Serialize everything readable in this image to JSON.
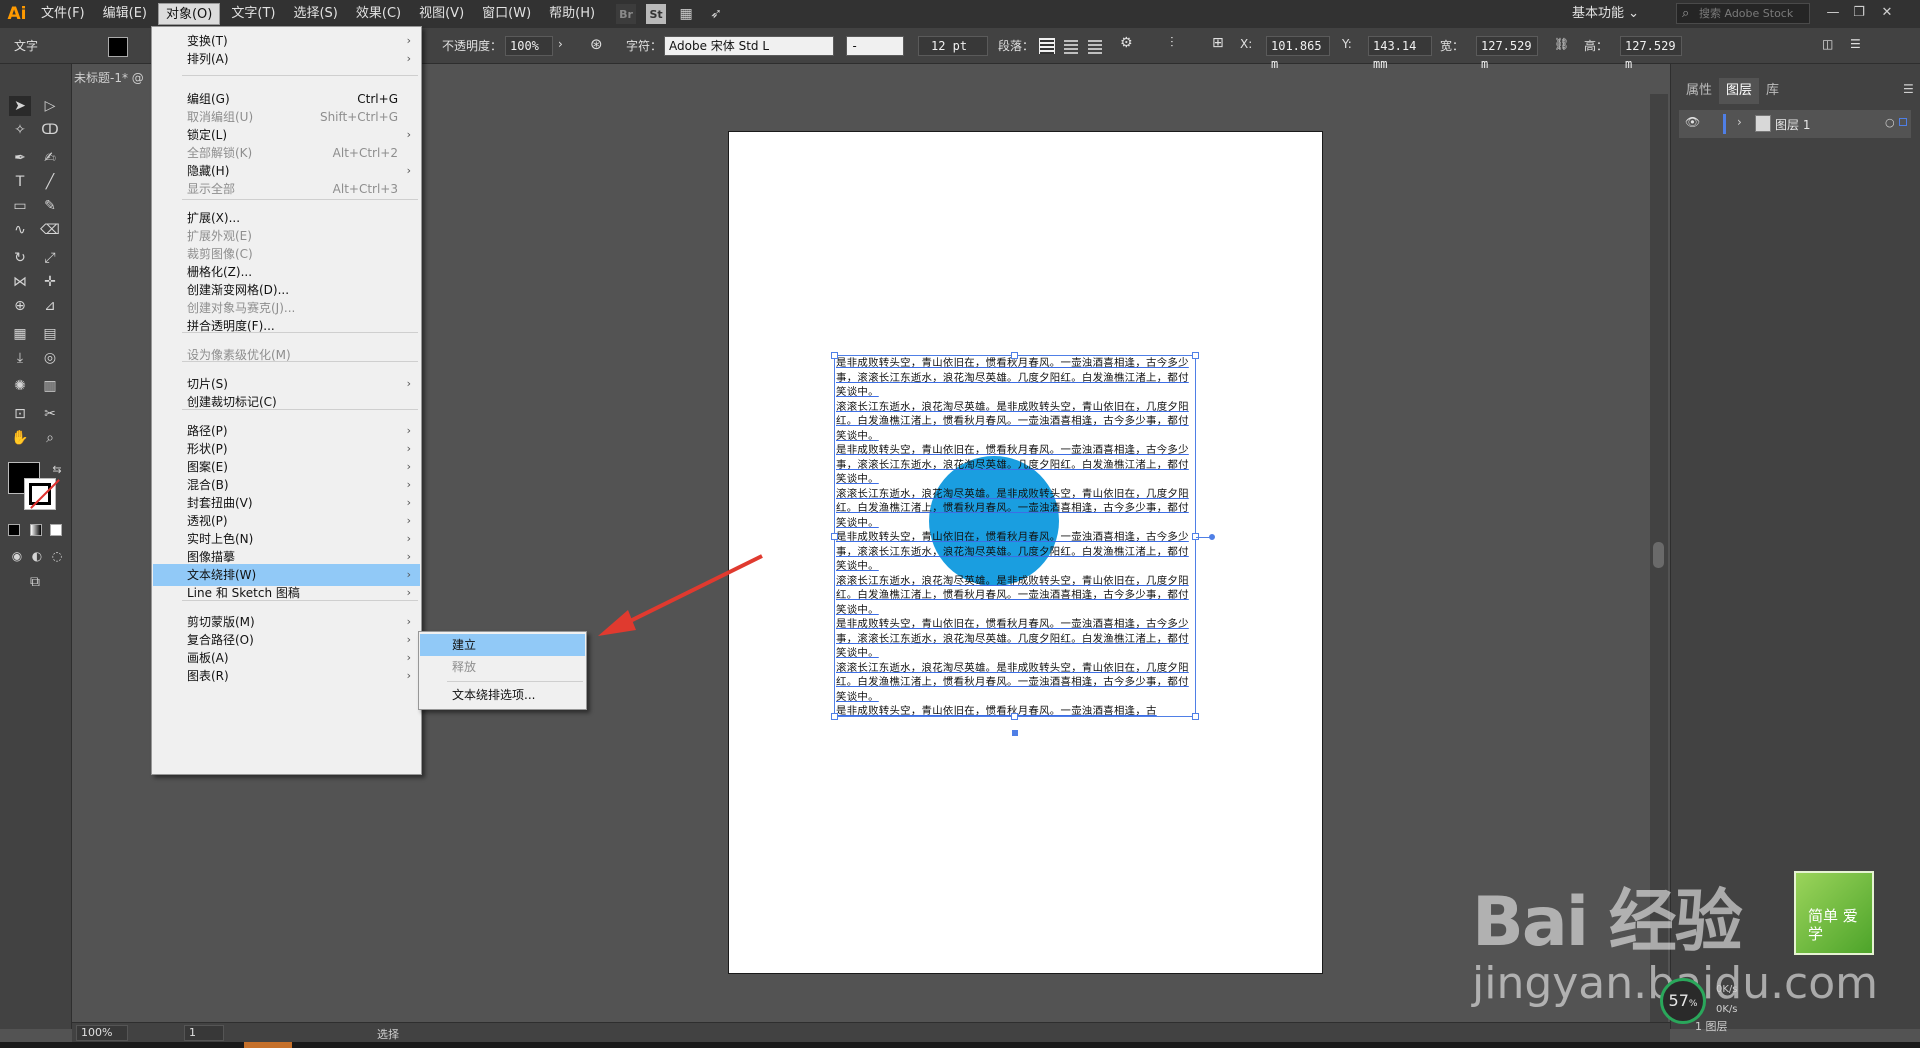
{
  "app": {
    "logo": "Ai"
  },
  "menubar": {
    "items": [
      "文件(F)",
      "编辑(E)",
      "对象(O)",
      "文字(T)",
      "选择(S)",
      "效果(C)",
      "视图(V)",
      "窗口(W)",
      "帮助(H)"
    ],
    "icons": [
      "Br",
      "St"
    ],
    "workspace": "基本功能",
    "search_placeholder": "搜索 Adobe Stock"
  },
  "controlbar": {
    "tool_label": "文字",
    "opacity_label": "不透明度：",
    "opacity_value": "100%",
    "char_label": "字符：",
    "font_name": "Adobe 宋体 Std L",
    "font_style": "-",
    "font_size": "12 pt",
    "para_label": "段落：",
    "x_label": "X:",
    "x_value": "101.865 m",
    "y_label": "Y:",
    "y_value": "143.14 mm",
    "w_label": "宽：",
    "w_value": "127.529 m",
    "h_label": "高：",
    "h_value": "127.529 m"
  },
  "document": {
    "tab_title": "未标题-1* @"
  },
  "object_menu": {
    "items": [
      {
        "label": "变换(T)",
        "shortcut": "",
        "submenu": true,
        "disabled": false
      },
      {
        "label": "排列(A)",
        "shortcut": "",
        "submenu": true,
        "disabled": false
      },
      {
        "label": "编组(G)",
        "shortcut": "Ctrl+G",
        "submenu": false,
        "disabled": false
      },
      {
        "label": "取消编组(U)",
        "shortcut": "Shift+Ctrl+G",
        "submenu": false,
        "disabled": true
      },
      {
        "label": "锁定(L)",
        "shortcut": "",
        "submenu": true,
        "disabled": false
      },
      {
        "label": "全部解锁(K)",
        "shortcut": "Alt+Ctrl+2",
        "submenu": false,
        "disabled": true
      },
      {
        "label": "隐藏(H)",
        "shortcut": "",
        "submenu": true,
        "disabled": false
      },
      {
        "label": "显示全部",
        "shortcut": "Alt+Ctrl+3",
        "submenu": false,
        "disabled": true
      },
      {
        "label": "扩展(X)...",
        "shortcut": "",
        "submenu": false,
        "disabled": false
      },
      {
        "label": "扩展外观(E)",
        "shortcut": "",
        "submenu": false,
        "disabled": true
      },
      {
        "label": "裁剪图像(C)",
        "shortcut": "",
        "submenu": false,
        "disabled": true
      },
      {
        "label": "栅格化(Z)...",
        "shortcut": "",
        "submenu": false,
        "disabled": false
      },
      {
        "label": "创建渐变网格(D)...",
        "shortcut": "",
        "submenu": false,
        "disabled": false
      },
      {
        "label": "创建对象马赛克(J)...",
        "shortcut": "",
        "submenu": false,
        "disabled": true
      },
      {
        "label": "拼合透明度(F)...",
        "shortcut": "",
        "submenu": false,
        "disabled": false
      },
      {
        "label": "设为像素级优化(M)",
        "shortcut": "",
        "submenu": false,
        "disabled": true
      },
      {
        "label": "切片(S)",
        "shortcut": "",
        "submenu": true,
        "disabled": false
      },
      {
        "label": "创建裁切标记(C)",
        "shortcut": "",
        "submenu": false,
        "disabled": false
      },
      {
        "label": "路径(P)",
        "shortcut": "",
        "submenu": true,
        "disabled": false
      },
      {
        "label": "形状(P)",
        "shortcut": "",
        "submenu": true,
        "disabled": false
      },
      {
        "label": "图案(E)",
        "shortcut": "",
        "submenu": true,
        "disabled": false
      },
      {
        "label": "混合(B)",
        "shortcut": "",
        "submenu": true,
        "disabled": false
      },
      {
        "label": "封套扭曲(V)",
        "shortcut": "",
        "submenu": true,
        "disabled": false
      },
      {
        "label": "透视(P)",
        "shortcut": "",
        "submenu": true,
        "disabled": false
      },
      {
        "label": "实时上色(N)",
        "shortcut": "",
        "submenu": true,
        "disabled": false
      },
      {
        "label": "图像描摹",
        "shortcut": "",
        "submenu": true,
        "disabled": false
      },
      {
        "label": "文本绕排(W)",
        "shortcut": "",
        "submenu": true,
        "disabled": false
      },
      {
        "label": "Line 和 Sketch 图稿",
        "shortcut": "",
        "submenu": true,
        "disabled": false
      },
      {
        "label": "剪切蒙版(M)",
        "shortcut": "",
        "submenu": true,
        "disabled": false
      },
      {
        "label": "复合路径(O)",
        "shortcut": "",
        "submenu": true,
        "disabled": false
      },
      {
        "label": "画板(A)",
        "shortcut": "",
        "submenu": true,
        "disabled": false
      },
      {
        "label": "图表(R)",
        "shortcut": "",
        "submenu": true,
        "disabled": false
      }
    ],
    "highlighted": "文本绕排(W)"
  },
  "wrap_submenu": {
    "create": "建立",
    "release": "释放",
    "options": "文本绕排选项..."
  },
  "canvas_text": {
    "paragraphs": [
      "是非成败转头空，青山依旧在，惯看秋月春风。一壶浊酒喜相逢，古今多少事，滚滚长江东逝水，浪花淘尽英雄。几度夕阳红。白发渔樵江渚上，都付笑谈中。",
      "滚滚长江东逝水，浪花淘尽英雄。是非成败转头空，青山依旧在，几度夕阳红。白发渔樵江渚上，惯看秋月春风。一壶浊酒喜相逢，古今多少事，都付笑谈中。",
      "是非成败转头空，青山依旧在，惯看秋月春风。一壶浊酒喜相逢，古今多少事，滚滚长江东逝水，浪花淘尽英雄。几度夕阳红。白发渔樵江渚上，都付笑谈中。",
      "滚滚长江东逝水，浪花淘尽英雄。是非成败转头空，青山依旧在，几度夕阳红。白发渔樵江渚上，惯看秋月春风。一壶浊酒喜相逢，古今多少事，都付笑谈中。",
      "是非成败转头空，青山依旧在，惯看秋月春风。一壶浊酒喜相逢，古今多少事，滚滚长江东逝水，浪花淘尽英雄。几度夕阳红。白发渔樵江渚上，都付笑谈中。",
      "滚滚长江东逝水，浪花淘尽英雄。是非成败转头空，青山依旧在，几度夕阳红。白发渔樵江渚上，惯看秋月春风。一壶浊酒喜相逢，古今多少事，都付笑谈中。",
      "是非成败转头空，青山依旧在，惯看秋月春风。一壶浊酒喜相逢，古今多少事，滚滚长江东逝水，浪花淘尽英雄。几度夕阳红。白发渔樵江渚上，都付笑谈中。",
      "滚滚长江东逝水，浪花淘尽英雄。是非成败转头空，青山依旧在，几度夕阳红。白发渔樵江渚上，惯看秋月春风。一壶浊酒喜相逢，古今多少事，都付笑谈中。",
      "是非成败转头空，青山依旧在，惯看秋月春风。一壶浊酒喜相逢，古"
    ],
    "circle_color": "#1a9ee0"
  },
  "layers_panel": {
    "tabs": [
      "属性",
      "图层",
      "库"
    ],
    "active_tab": "图层",
    "layer_name": "图层 1",
    "footer_label": "1 图层"
  },
  "statusbar": {
    "zoom": "100%",
    "page": "1",
    "tool": "选择"
  },
  "watermark": {
    "brand": "Bai 经验",
    "url": "jingyan.baidu.com",
    "badge": "简单 爱学",
    "perf": "57",
    "perf_unit": "%",
    "speed1": "0K/s",
    "speed2": "0K/s"
  },
  "colors": {
    "menu_highlight": "#91c9f7",
    "selection_blue": "#4f7fe6",
    "arrow_red": "#e03a2f",
    "circle": "#1a9ee0"
  }
}
